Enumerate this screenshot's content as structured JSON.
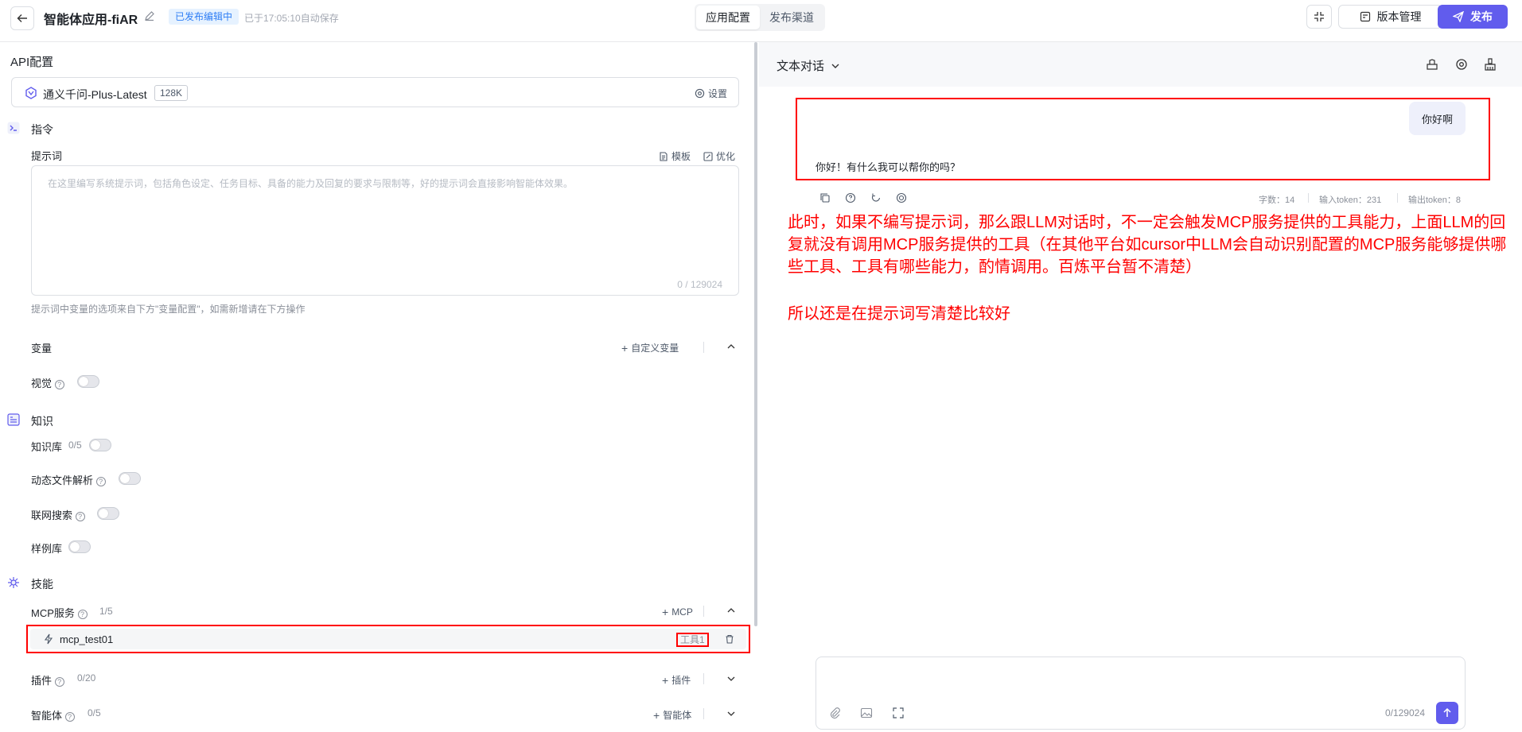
{
  "header": {
    "back_icon": "arrow-left-icon",
    "app_title": "智能体应用-fiAR",
    "status_badge": "已发布编辑中",
    "autosave": "已于17:05:10自动保存",
    "tabs": [
      {
        "label": "应用配置",
        "active": true
      },
      {
        "label": "发布渠道",
        "active": false
      }
    ],
    "version_label": "版本管理",
    "publish_label": "发布",
    "accent_color": "#615ced"
  },
  "left": {
    "api_title": "API配置",
    "model": {
      "name": "通义千问-Plus-Latest",
      "context": "128K",
      "settings_label": "设置"
    },
    "instruction": {
      "title": "指令",
      "prompt_label": "提示词",
      "template_label": "模板",
      "optimize_label": "优化",
      "placeholder": "在这里编写系统提示词，包括角色设定、任务目标、具备的能力及回复的要求与限制等，好的提示词会直接影响智能体效果。",
      "counter": "0 / 129024",
      "hint": "提示词中变量的选项来自下方\"变量配置\"，如需新增请在下方操作"
    },
    "variables": {
      "label": "变量",
      "add_label": "自定义变量"
    },
    "vision": {
      "label": "视觉",
      "enabled": false
    },
    "knowledge": {
      "title": "知识",
      "kb_label": "知识库",
      "kb_count": "0/5",
      "file_parse_label": "动态文件解析",
      "web_search_label": "联网搜索",
      "examples_label": "样例库"
    },
    "skills": {
      "title": "技能",
      "mcp_label": "MCP服务",
      "mcp_count": "1/5",
      "mcp_add": "MCP",
      "mcp_items": [
        {
          "name": "mcp_test01",
          "tool_badge": "工具1"
        }
      ],
      "plugin_label": "插件",
      "plugin_count": "0/20",
      "plugin_add": "插件",
      "agent_label": "智能体",
      "agent_count": "0/5",
      "agent_add": "智能体"
    }
  },
  "right": {
    "mode_label": "文本对话",
    "user_message": "你好啊",
    "bot_message": "你好！有什么我可以帮你的吗？",
    "stats": {
      "chars": "字数：14",
      "input_tokens": "输入token：231",
      "output_tokens": "输出token：8"
    },
    "annotation_1": "此时，如果不编写提示词，那么跟LLM对话时，不一定会触发MCP服务提供的工具能力，上面LLM的回复就没有调用MCP服务提供的工具（在其他平台如cursor中LLM会自动识别配置的MCP服务能够提供哪些工具、工具有哪些能力，酌情调用。百炼平台暂不清楚）",
    "annotation_2": "所以还是在提示词写清楚比较好",
    "input_counter": "0/129024",
    "annotation_color": "#ff0000"
  }
}
